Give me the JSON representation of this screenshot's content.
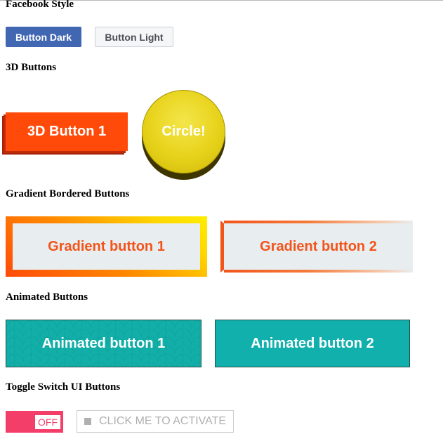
{
  "sections": {
    "facebook": {
      "title": "Facebook Style",
      "dark_label": "Button Dark",
      "light_label": "Button Light"
    },
    "three_d": {
      "title": "3D Buttons",
      "button_label": "3D Button 1",
      "circle_label": "Circle!"
    },
    "gradient": {
      "title": "Gradient Bordered Buttons",
      "button1_label": "Gradient button 1",
      "button2_label": "Gradient button 2"
    },
    "animated": {
      "title": "Animated Buttons",
      "button1_label": "Animated button 1",
      "button2_label": "Animated button 2"
    },
    "toggle": {
      "title": "Toggle Switch UI Buttons",
      "switch_state": "OFF",
      "activate_label": "CLICK ME TO ACTIVATE"
    }
  },
  "icons": {
    "activate_icon": "square-icon"
  },
  "colors": {
    "facebook_blue": "#4267b2",
    "orange_red": "#ff4a0a",
    "yellow": "#e7d21a",
    "gradient_text": "#f2541b",
    "teal": "#12afa9",
    "toggle_pink": "#f33e6a"
  }
}
